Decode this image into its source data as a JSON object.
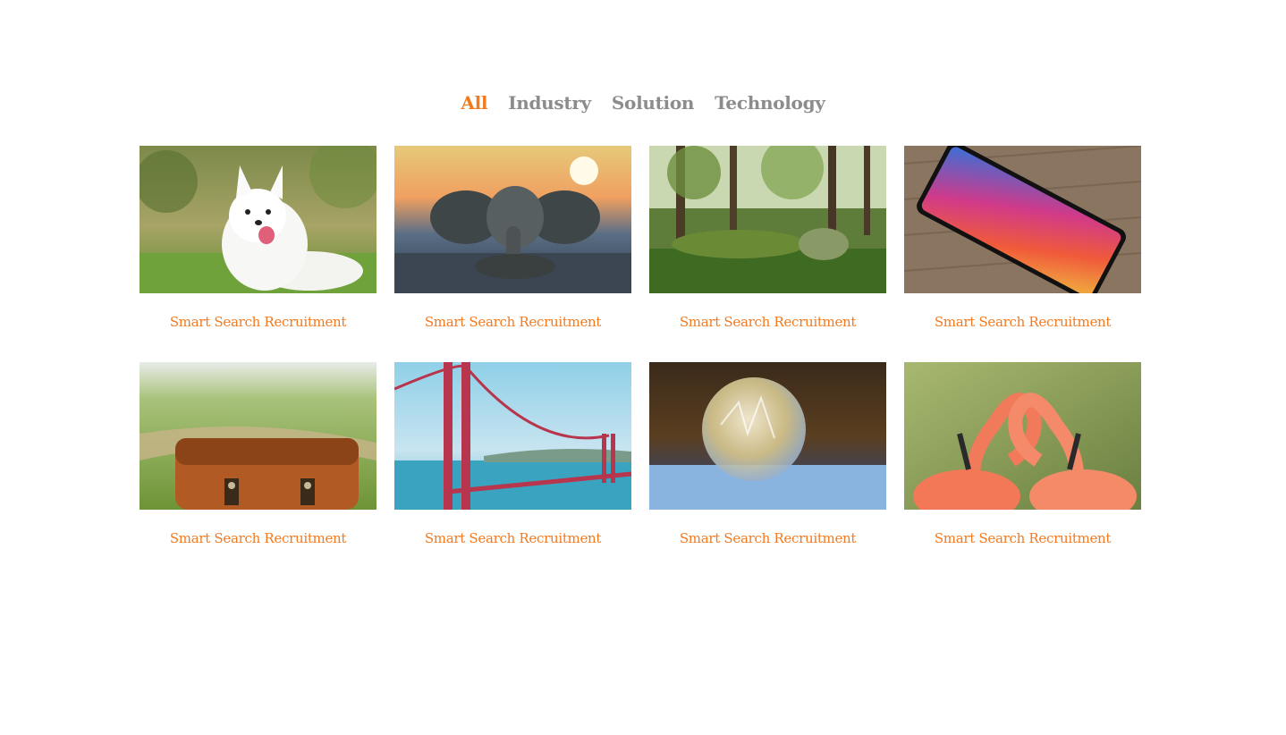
{
  "filters": [
    {
      "label": "All",
      "active": true
    },
    {
      "label": "Industry",
      "active": false
    },
    {
      "label": "Solution",
      "active": false
    },
    {
      "label": "Technology",
      "active": false
    }
  ],
  "items": [
    {
      "image": "white-dog-photo",
      "title": "Smart Search Recruitment"
    },
    {
      "image": "elephant-statue-photo",
      "title": "Smart Search Recruitment"
    },
    {
      "image": "forest-sculpture-photo",
      "title": "Smart Search Recruitment"
    },
    {
      "image": "smartphone-photo",
      "title": "Smart Search Recruitment"
    },
    {
      "image": "leather-bag-photo",
      "title": "Smart Search Recruitment"
    },
    {
      "image": "golden-gate-bridge-photo",
      "title": "Smart Search Recruitment"
    },
    {
      "image": "frozen-bubble-photo",
      "title": "Smart Search Recruitment"
    },
    {
      "image": "flamingos-photo",
      "title": "Smart Search Recruitment"
    }
  ],
  "colors": {
    "accent": "#f47a20",
    "inactive": "#8c8c8c"
  }
}
